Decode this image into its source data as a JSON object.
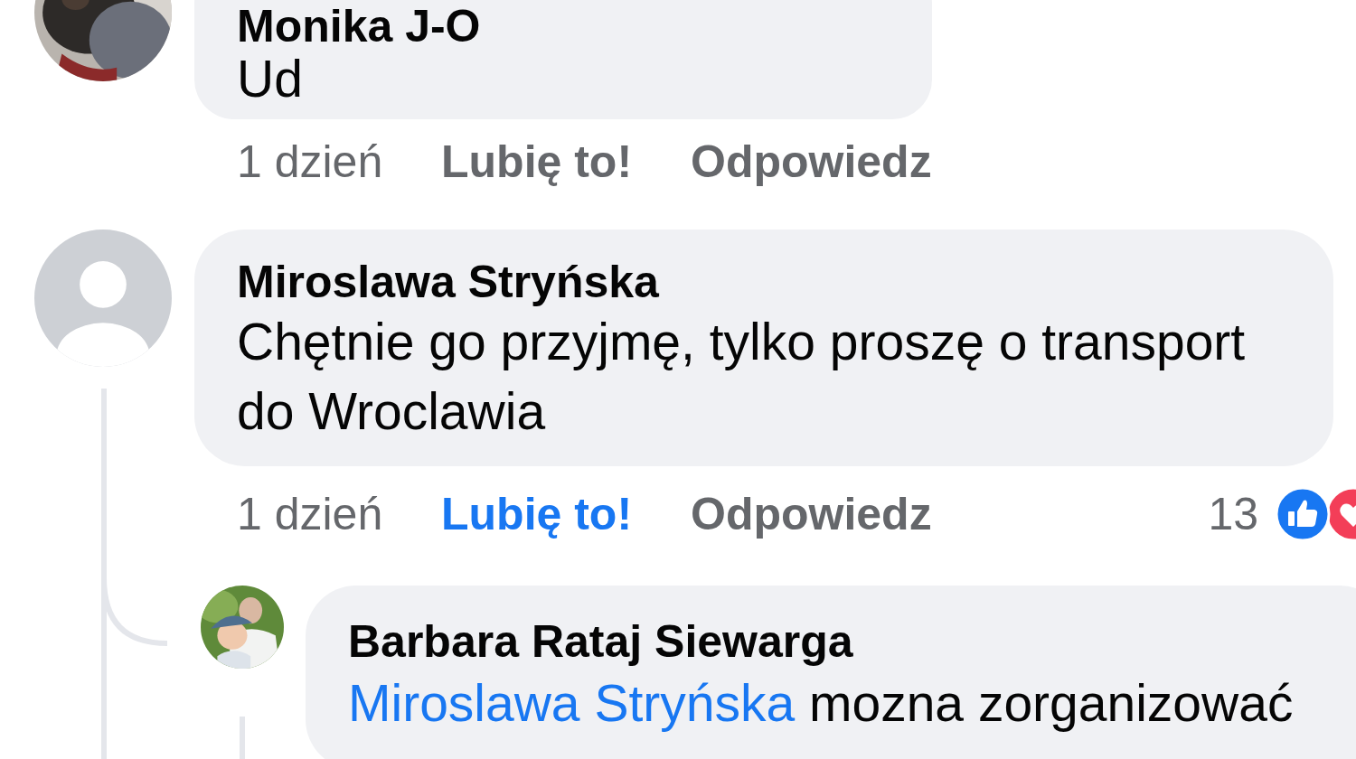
{
  "comments": [
    {
      "author": "Monika J-O",
      "text": "Ud",
      "time": "1 dzień",
      "like": {
        "label": "Lubię to!",
        "selected": false
      },
      "reply": "Odpowiedz"
    },
    {
      "author": "Miroslawa Stryńska",
      "avatar": {
        "kind": "default"
      },
      "text": "Chętnie go przyjmę, tylko proszę o transport do Wroclawia",
      "time": "1 dzień",
      "like": {
        "label": "Lubię to!",
        "selected": true
      },
      "reply": "Odpowiedz",
      "reaction_count": "13",
      "reactions": [
        {
          "kind": "like"
        },
        {
          "kind": "love"
        }
      ],
      "replies": [
        {
          "author": "Barbara Rataj Siewarga",
          "mention": "Miroslawa Stryńska",
          "text": "mozna zorganizować"
        }
      ]
    }
  ]
}
